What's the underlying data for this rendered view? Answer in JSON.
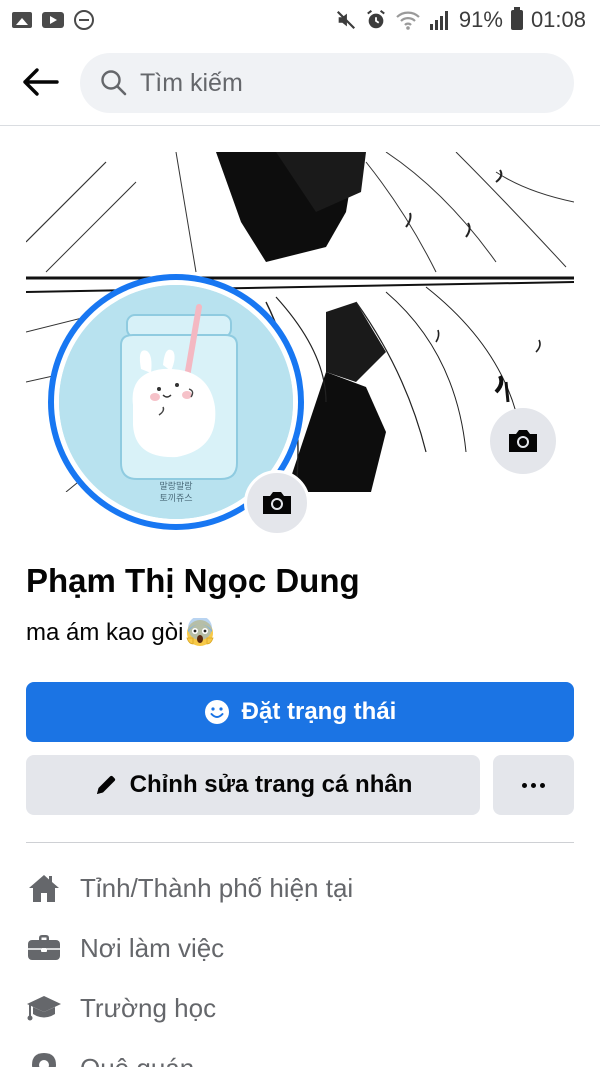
{
  "status_bar": {
    "battery": "91%",
    "time": "01:08",
    "icons": [
      "gallery-icon",
      "youtube-icon",
      "do-not-disturb-icon",
      "mute-icon",
      "alarm-icon",
      "wifi-icon",
      "signal-icon",
      "battery-icon"
    ]
  },
  "search": {
    "placeholder": "Tìm kiếm"
  },
  "profile": {
    "name": "Phạm Thị Ngọc Dung",
    "bio": "ma ám kao gòi",
    "avatar_caption_line1": "말랑말랑",
    "avatar_caption_line2": "토끼쥬스"
  },
  "actions": {
    "set_status_label": "Đặt trạng thái",
    "edit_profile_label": "Chỉnh sửa trang cá nhân"
  },
  "details": [
    {
      "icon": "home-icon",
      "label": "Tỉnh/Thành phố hiện tại"
    },
    {
      "icon": "briefcase-icon",
      "label": "Nơi làm việc"
    },
    {
      "icon": "graduation-cap-icon",
      "label": "Trường học"
    },
    {
      "icon": "location-pin-icon",
      "label": "Quê quán"
    }
  ],
  "colors": {
    "primary": "#1b74e4",
    "avatar_ring": "#1877f2",
    "secondary_button": "#e4e6eb",
    "muted_text": "#65676b"
  }
}
